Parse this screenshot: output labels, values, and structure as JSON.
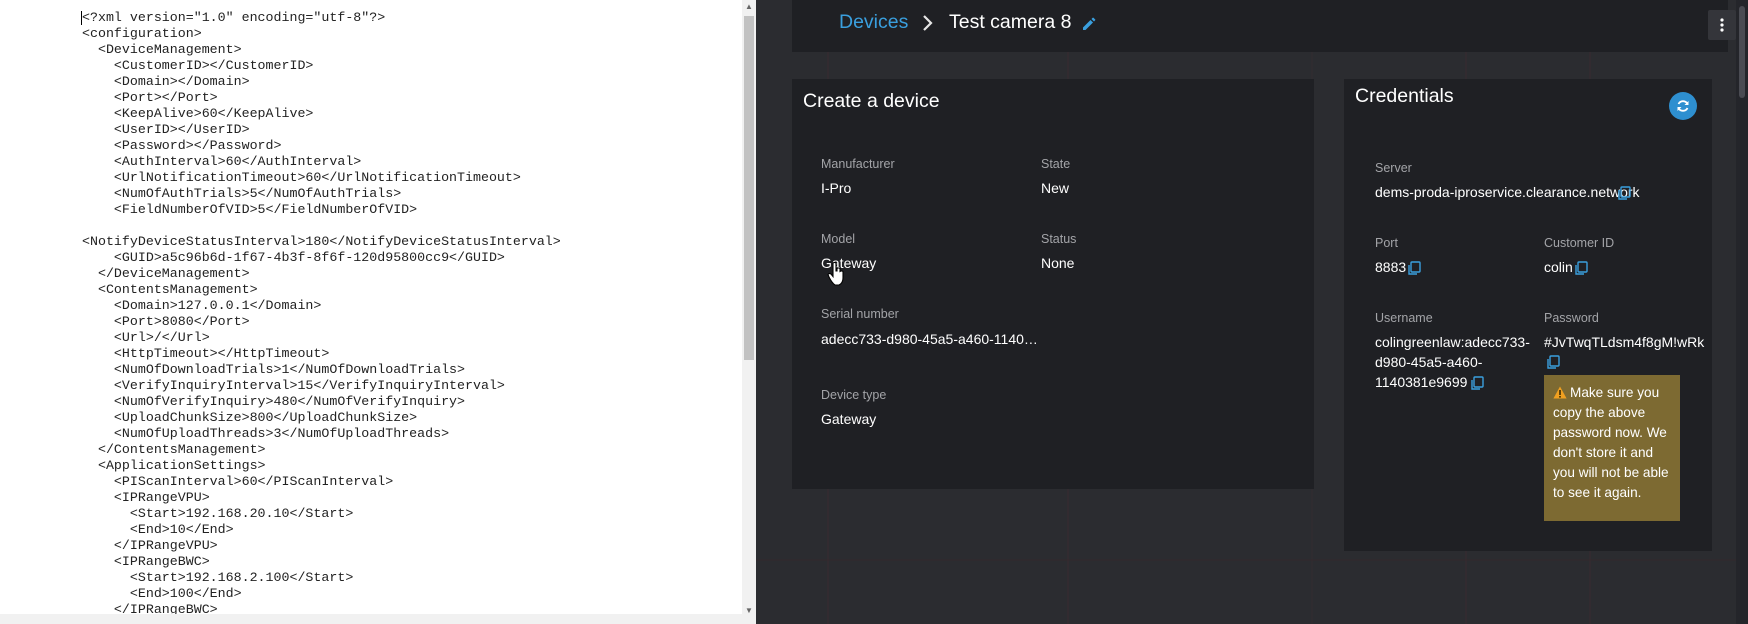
{
  "editor": {
    "lines": [
      "<?xml version=\"1.0\" encoding=\"utf-8\"?>",
      "<configuration>",
      "  <DeviceManagement>",
      "    <CustomerID></CustomerID>",
      "    <Domain></Domain>",
      "    <Port></Port>",
      "    <KeepAlive>60</KeepAlive>",
      "    <UserID></UserID>",
      "    <Password></Password>",
      "    <AuthInterval>60</AuthInterval>",
      "    <UrlNotificationTimeout>60</UrlNotificationTimeout>",
      "    <NumOfAuthTrials>5</NumOfAuthTrials>",
      "    <FieldNumberOfVID>5</FieldNumberOfVID>",
      "",
      "<NotifyDeviceStatusInterval>180</NotifyDeviceStatusInterval>",
      "    <GUID>a5c96b6d-1f67-4b3f-8f6f-120d95800cc9</GUID>",
      "  </DeviceManagement>",
      "  <ContentsManagement>",
      "    <Domain>127.0.0.1</Domain>",
      "    <Port>8080</Port>",
      "    <Url>/</Url>",
      "    <HttpTimeout></HttpTimeout>",
      "    <NumOfDownloadTrials>1</NumOfDownloadTrials>",
      "    <VerifyInquiryInterval>15</VerifyInquiryInterval>",
      "    <NumOfVerifyInquiry>480</NumOfVerifyInquiry>",
      "    <UploadChunkSize>800</UploadChunkSize>",
      "    <NumOfUploadThreads>3</NumOfUploadThreads>",
      "  </ContentsManagement>",
      "  <ApplicationSettings>",
      "    <PIScanInterval>60</PIScanInterval>",
      "    <IPRangeVPU>",
      "      <Start>192.168.20.10</Start>",
      "      <End>10</End>",
      "    </IPRangeVPU>",
      "    <IPRangeBWC>",
      "      <Start>192.168.2.100</Start>",
      "      <End>100</End>",
      "    </IPRangeBWC>"
    ]
  },
  "header": {
    "breadcrumb_root": "Devices",
    "title": "Test camera 8"
  },
  "device_card": {
    "title": "Create a device",
    "manufacturer_label": "Manufacturer",
    "manufacturer_value": "I-Pro",
    "state_label": "State",
    "state_value": "New",
    "model_label": "Model",
    "model_value": "Gateway",
    "status_label": "Status",
    "status_value": "None",
    "serial_label": "Serial number",
    "serial_value": "adecc733-d980-45a5-a460-1140…",
    "device_type_label": "Device type",
    "device_type_value": "Gateway"
  },
  "credentials_card": {
    "title": "Credentials",
    "server_label": "Server",
    "server_value": "dems-proda-iproservice.clearance.network",
    "port_label": "Port",
    "port_value": "8883",
    "customer_id_label": "Customer ID",
    "customer_id_value": "colin",
    "username_label": "Username",
    "username_line1": "colingreenlaw:adecc733-",
    "username_line2": "d980-45a5-a460-",
    "username_line3": "1140381e9699",
    "password_label": "Password",
    "password_value": "#JvTwqTLdsm4f8gM!wRk",
    "warning_text": "Make sure you copy the above password now. We don't store it and you will not be able to see it again."
  },
  "colors": {
    "accent": "#3a9fde",
    "app_background": "#2b2c30",
    "card_background": "#1f2024",
    "warning_background": "#7d6a32"
  },
  "icons": [
    "pencil-icon",
    "more-vertical-icon",
    "refresh-icon",
    "copy-icon",
    "warning-icon",
    "chevron-right-icon",
    "mouse-cursor-icon"
  ]
}
